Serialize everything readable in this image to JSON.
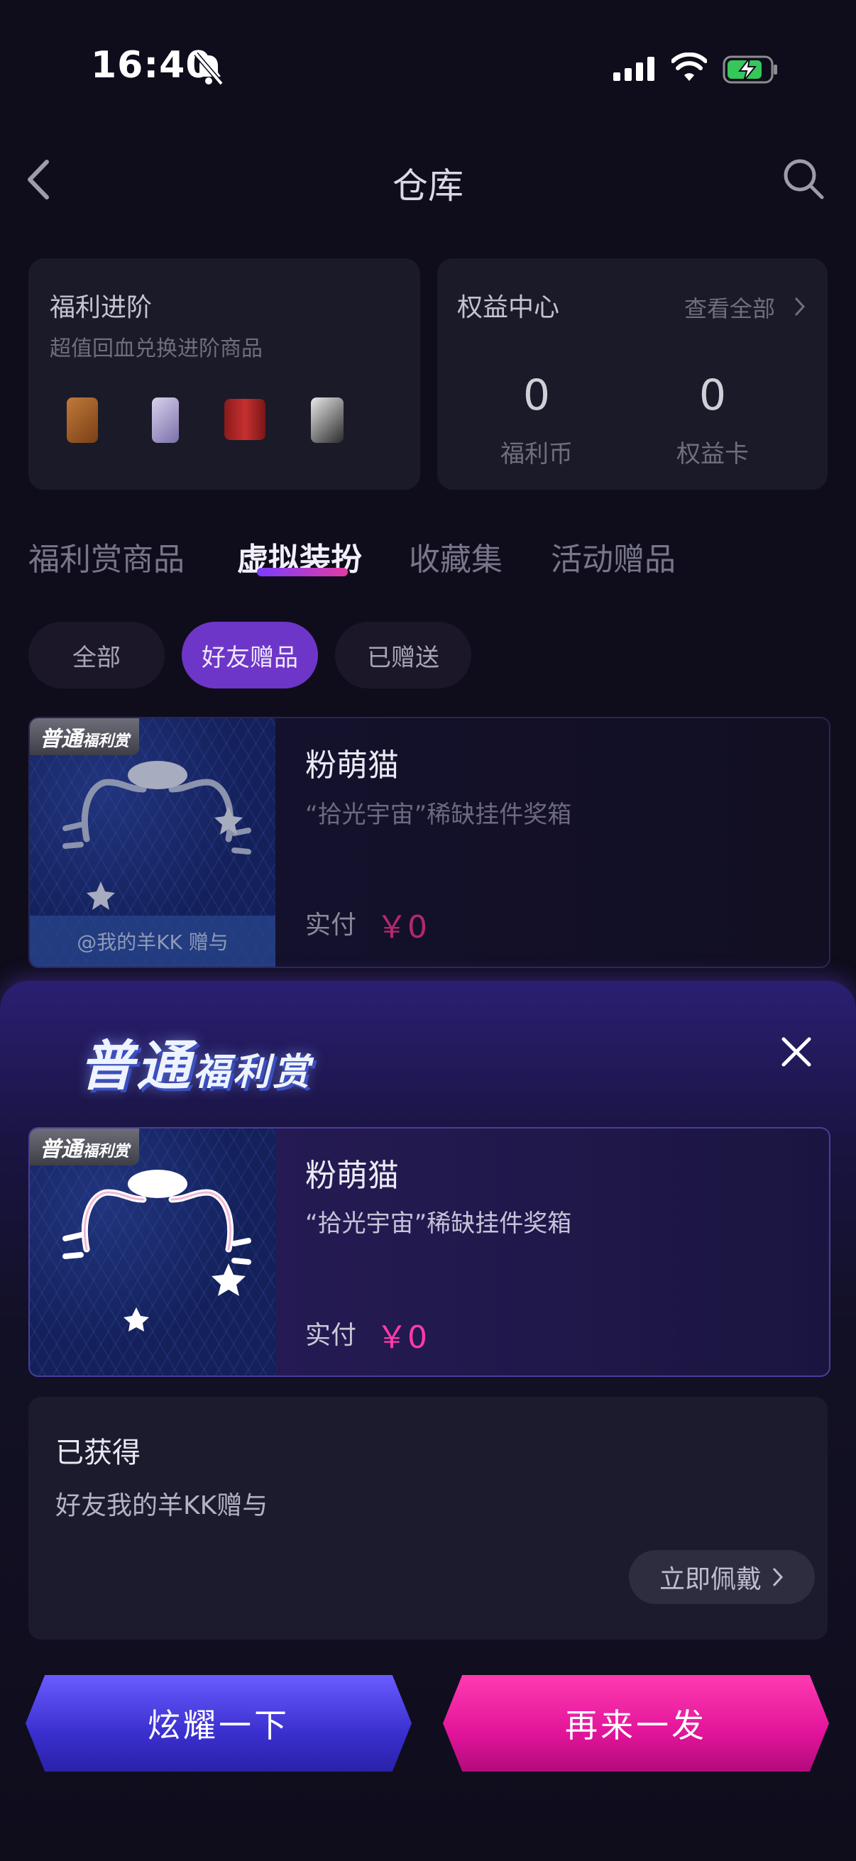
{
  "status_bar": {
    "time": "16:40"
  },
  "header": {
    "title": "仓库"
  },
  "welfare_card": {
    "title": "福利进阶",
    "subtitle": "超值回血兑换进阶商品"
  },
  "rights_card": {
    "title": "权益中心",
    "view_all": "查看全部",
    "stats": [
      {
        "value": "0",
        "label": "福利币"
      },
      {
        "value": "0",
        "label": "权益卡"
      }
    ]
  },
  "tabs": [
    "福利赏商品",
    "虚拟装扮",
    "收藏集",
    "活动赠品"
  ],
  "active_tab": "虚拟装扮",
  "chips": [
    "全部",
    "好友赠品",
    "已赠送"
  ],
  "active_chip": "好友赠品",
  "list_item": {
    "badge": "普通",
    "badge_sub": "福利赏",
    "gift_from": "@我的羊KK 赠与",
    "name": "粉萌猫",
    "desc": "“拾光宇宙”稀缺挂件奖箱",
    "pay_label": "实付",
    "price": "￥0"
  },
  "sheet": {
    "badge_main": "普通",
    "badge_sub": "福利赏",
    "item": {
      "badge": "普通",
      "badge_sub": "福利赏",
      "name": "粉萌猫",
      "desc": "“拾光宇宙”稀缺挂件奖箱",
      "pay_label": "实付",
      "price": "￥0"
    },
    "obtained_title": "已获得",
    "obtained_desc": "好友我的羊KK赠与",
    "wear_label": "立即佩戴",
    "btn_flaunt": "炫耀一下",
    "btn_again": "再来一发"
  },
  "colors": {
    "accent_purple": "#6e36c8",
    "accent_pink": "#ff3aa8",
    "btn_blue": "#4a3ce8",
    "btn_pink": "#e2149a"
  }
}
